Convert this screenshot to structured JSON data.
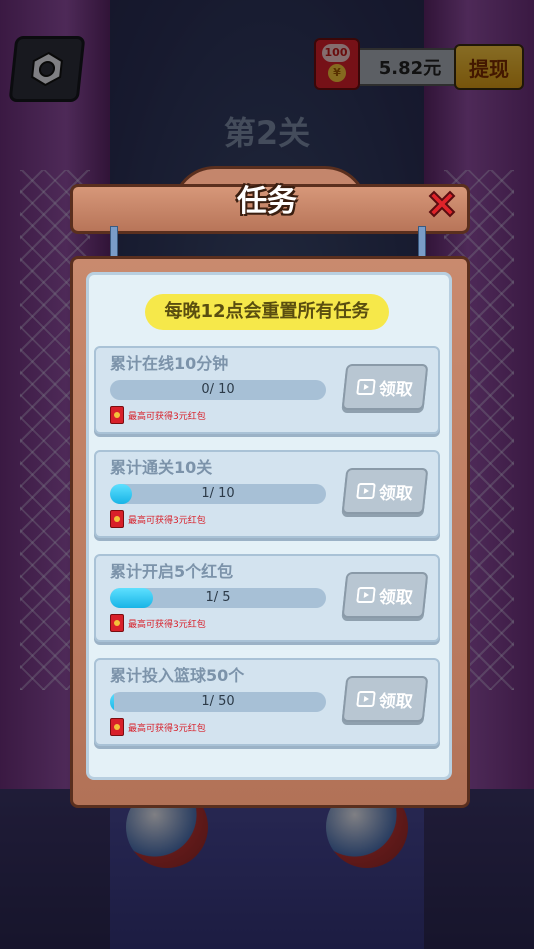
{
  "hud": {
    "redpack_count": "100",
    "redpack_coin": "¥",
    "balance": "5.82元",
    "withdraw_label": "提现",
    "level": "第2关"
  },
  "modal": {
    "title": "任务",
    "notice": "每晚12点会重置所有任务",
    "tasks": [
      {
        "title": "累计在线10分钟",
        "progress_text": "0/ 10",
        "progress": 0.0,
        "reward": "最高可获得3元红包",
        "claim_label": "领取"
      },
      {
        "title": "累计通关10关",
        "progress_text": "1/ 10",
        "progress": 0.1,
        "reward": "最高可获得3元红包",
        "claim_label": "领取"
      },
      {
        "title": "累计开启5个红包",
        "progress_text": "1/ 5",
        "progress": 0.2,
        "reward": "最高可获得3元红包",
        "claim_label": "领取"
      },
      {
        "title": "累计投入篮球50个",
        "progress_text": "1/ 50",
        "progress": 0.02,
        "reward": "最高可获得3元红包",
        "claim_label": "领取"
      }
    ]
  },
  "icons": [
    "gear-icon",
    "redpack-icon",
    "close-icon",
    "video-icon"
  ],
  "colors": {
    "progress": "#18b4e6",
    "notice_bg": "#f6e84a",
    "frame": "#b87559",
    "close": "#e0242a"
  }
}
